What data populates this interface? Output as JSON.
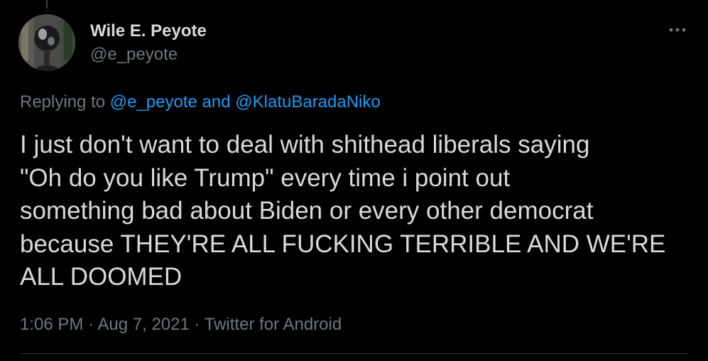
{
  "author": {
    "display_name": "Wile E. Peyote",
    "handle": "@e_peyote"
  },
  "reply_context": {
    "prefix": "Replying to ",
    "mention_1": "@e_peyote",
    "conjunction": " and ",
    "mention_2": "@KlatuBaradaNiko"
  },
  "tweet": {
    "text": "I just don't want to deal with shithead liberals saying\n\"Oh do you like Trump\" every time i point out\nsomething bad about Biden or every other democrat\nbecause THEY'RE ALL FUCKING TERRIBLE AND WE'RE\nALL DOOMED"
  },
  "meta": {
    "time": "1:06 PM",
    "separator_1": " · ",
    "date": "Aug 7, 2021",
    "separator_2": " · ",
    "source": "Twitter for Android"
  },
  "icons": {
    "more": "more-horizontal-icon"
  },
  "colors": {
    "background": "#000000",
    "text": "#d9d9d9",
    "secondary": "#6e767d",
    "link": "#1d9bf0"
  }
}
